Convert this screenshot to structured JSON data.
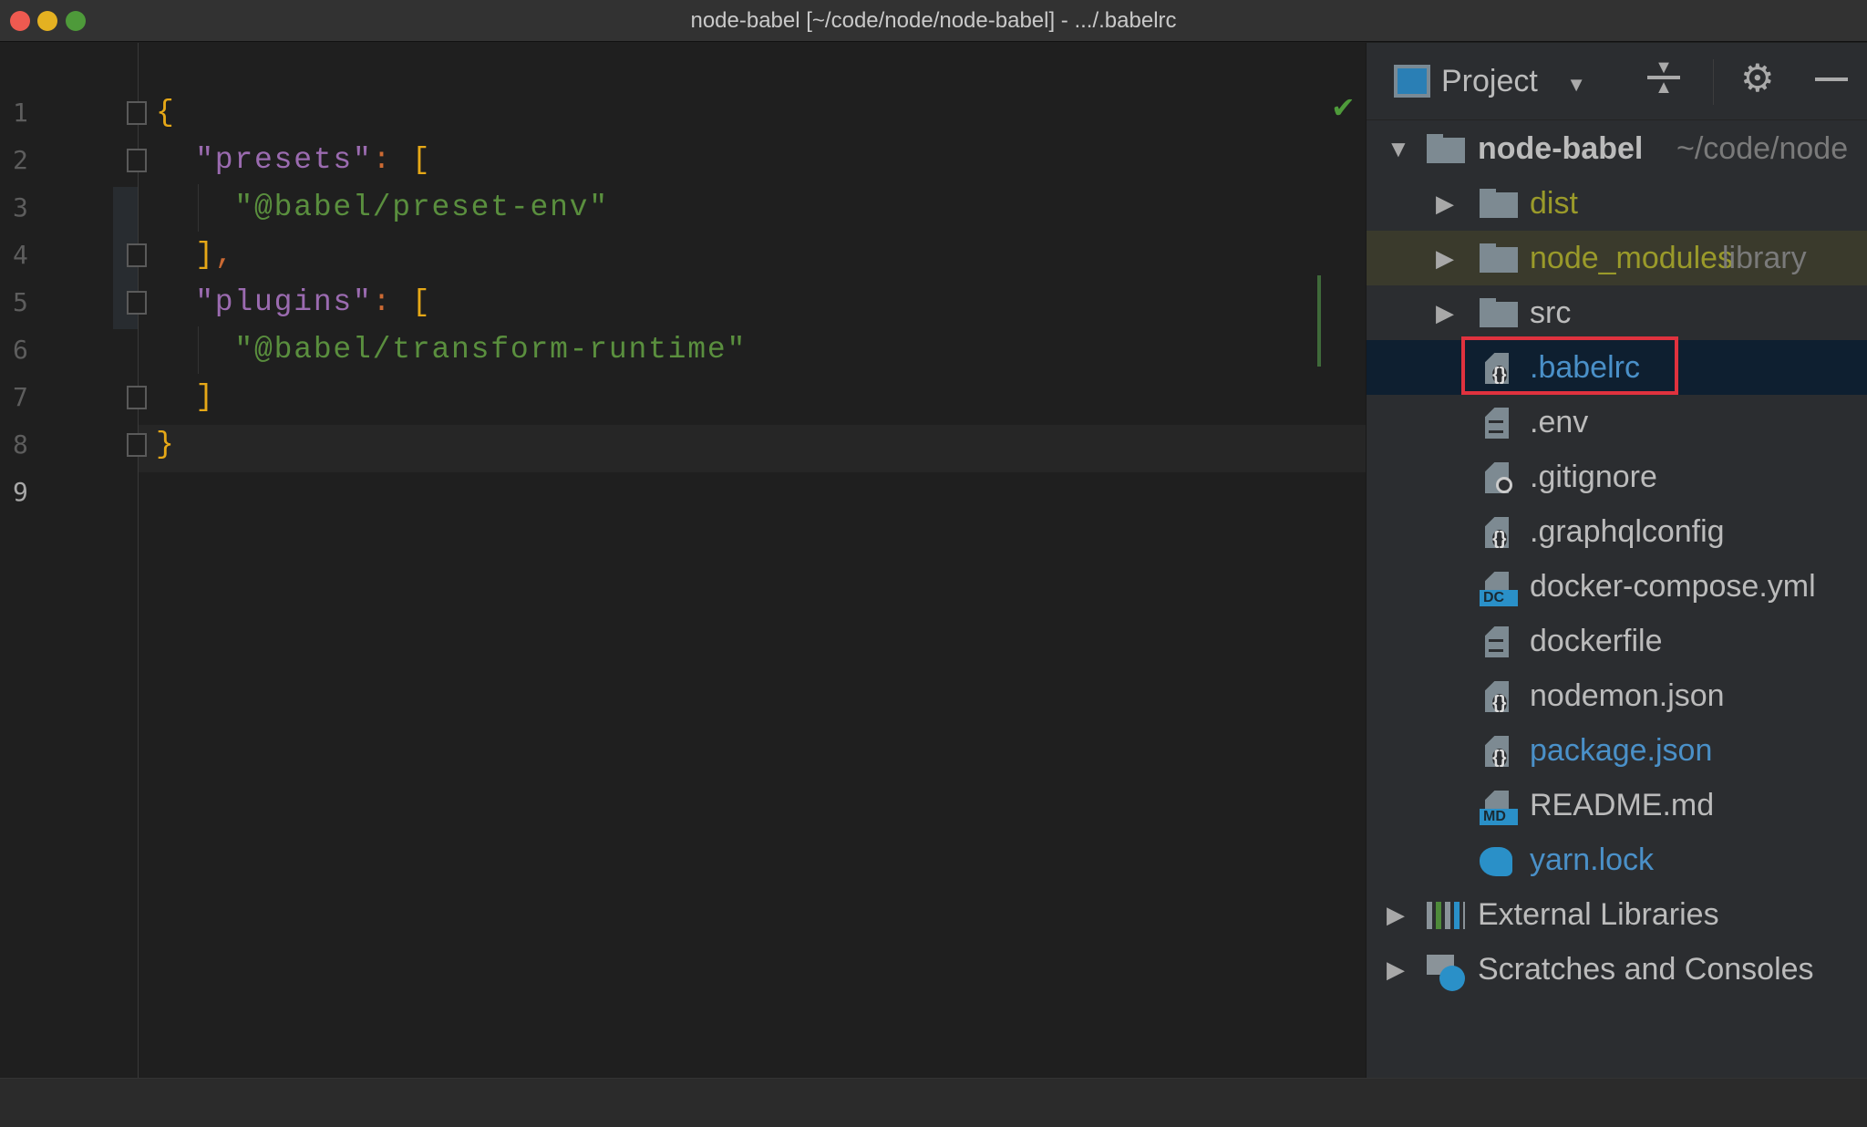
{
  "window": {
    "title": "node-babel [~/code/node/node-babel] - .../.babelrc"
  },
  "editor": {
    "line_numbers": [
      "1",
      "2",
      "3",
      "4",
      "5",
      "6",
      "7",
      "8",
      "9"
    ],
    "lines": [
      [
        {
          "t": "{",
          "c": "b"
        }
      ],
      [
        {
          "t": "  \"presets\"",
          "c": "k"
        },
        {
          "t": ": ",
          "c": "p"
        },
        {
          "t": "[",
          "c": "b"
        }
      ],
      [
        {
          "t": "    \"@babel/preset-env\"",
          "c": "s"
        }
      ],
      [
        {
          "t": "  ]",
          "c": "b"
        },
        {
          "t": ",",
          "c": "p"
        }
      ],
      [
        {
          "t": "  \"plugins\"",
          "c": "k"
        },
        {
          "t": ": ",
          "c": "p"
        },
        {
          "t": "[",
          "c": "b"
        }
      ],
      [
        {
          "t": "    \"@babel/transform-runtime\"",
          "c": "s"
        }
      ],
      [
        {
          "t": "  ]",
          "c": "b"
        }
      ],
      [
        {
          "t": "}",
          "c": "b"
        }
      ],
      []
    ],
    "current_line": "9",
    "inspection_status": "check-icon"
  },
  "project": {
    "title": "Project",
    "root": {
      "name": "node-babel",
      "path": "~/code/node"
    },
    "items": [
      {
        "name": "dist",
        "type": "folder",
        "color": "#9a9a2a"
      },
      {
        "name": "node_modules",
        "type": "folder",
        "color": "#9a9a2a",
        "suffix": "library"
      },
      {
        "name": "src",
        "type": "folder",
        "color": "#bbbbbb"
      },
      {
        "name": ".babelrc",
        "type": "json",
        "color": "#4a90c8",
        "selected": true
      },
      {
        "name": ".env",
        "type": "text",
        "color": "#bbbbbb"
      },
      {
        "name": ".gitignore",
        "type": "ignore",
        "color": "#bbbbbb"
      },
      {
        "name": ".graphqlconfig",
        "type": "json",
        "color": "#bbbbbb"
      },
      {
        "name": "docker-compose.yml",
        "type": "dc",
        "color": "#bbbbbb"
      },
      {
        "name": "dockerfile",
        "type": "text",
        "color": "#bbbbbb"
      },
      {
        "name": "nodemon.json",
        "type": "json",
        "color": "#bbbbbb"
      },
      {
        "name": "package.json",
        "type": "json",
        "color": "#4a90c8"
      },
      {
        "name": "README.md",
        "type": "md",
        "color": "#bbbbbb"
      },
      {
        "name": "yarn.lock",
        "type": "yarn",
        "color": "#4a90c8"
      }
    ],
    "bottom": [
      {
        "name": "External Libraries",
        "icon": "libraries-icon"
      },
      {
        "name": "Scratches and Consoles",
        "icon": "scratches-icon"
      }
    ],
    "badges": {
      "dc": "DC",
      "md": "MD"
    }
  }
}
